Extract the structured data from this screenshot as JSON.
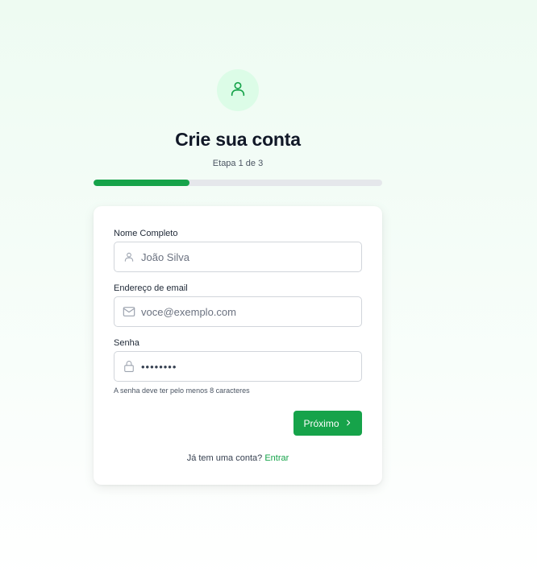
{
  "header": {
    "title": "Crie sua conta",
    "step_text": "Etapa 1 de 3",
    "progress_fraction": 0.333
  },
  "form": {
    "name": {
      "label": "Nome Completo",
      "placeholder": "João Silva",
      "icon": "user-icon"
    },
    "email": {
      "label": "Endereço de email",
      "placeholder": "voce@exemplo.com",
      "icon": "mail-icon"
    },
    "password": {
      "label": "Senha",
      "value": "••••••••",
      "icon": "lock-icon",
      "hint": "A senha deve ter pelo menos 8 caracteres"
    },
    "next_label": "Próximo"
  },
  "footer": {
    "question": "Já tem uma conta?",
    "signin_link": "Entrar"
  },
  "colors": {
    "accent": "#16a34a",
    "accent_light": "#dcfce7"
  }
}
